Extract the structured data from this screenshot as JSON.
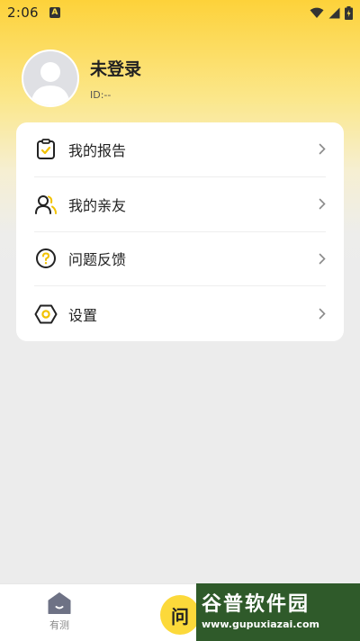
{
  "status": {
    "time": "2:06",
    "notif_glyph": "A"
  },
  "profile": {
    "name": "未登录",
    "id": "ID:--"
  },
  "menu": [
    {
      "label": "我的报告",
      "icon": "clipboard-check-icon"
    },
    {
      "label": "我的亲友",
      "icon": "contacts-icon"
    },
    {
      "label": "问题反馈",
      "icon": "question-icon"
    },
    {
      "label": "设置",
      "icon": "settings-icon"
    }
  ],
  "bottom_nav": {
    "home_label": "有测",
    "bubble_glyph": "问"
  },
  "watermark": {
    "main": "谷普软件园",
    "sub": "www.gupuxiazai.com"
  },
  "colors": {
    "accent": "#fdd23a",
    "card": "#ffffff",
    "background": "#ececec"
  }
}
